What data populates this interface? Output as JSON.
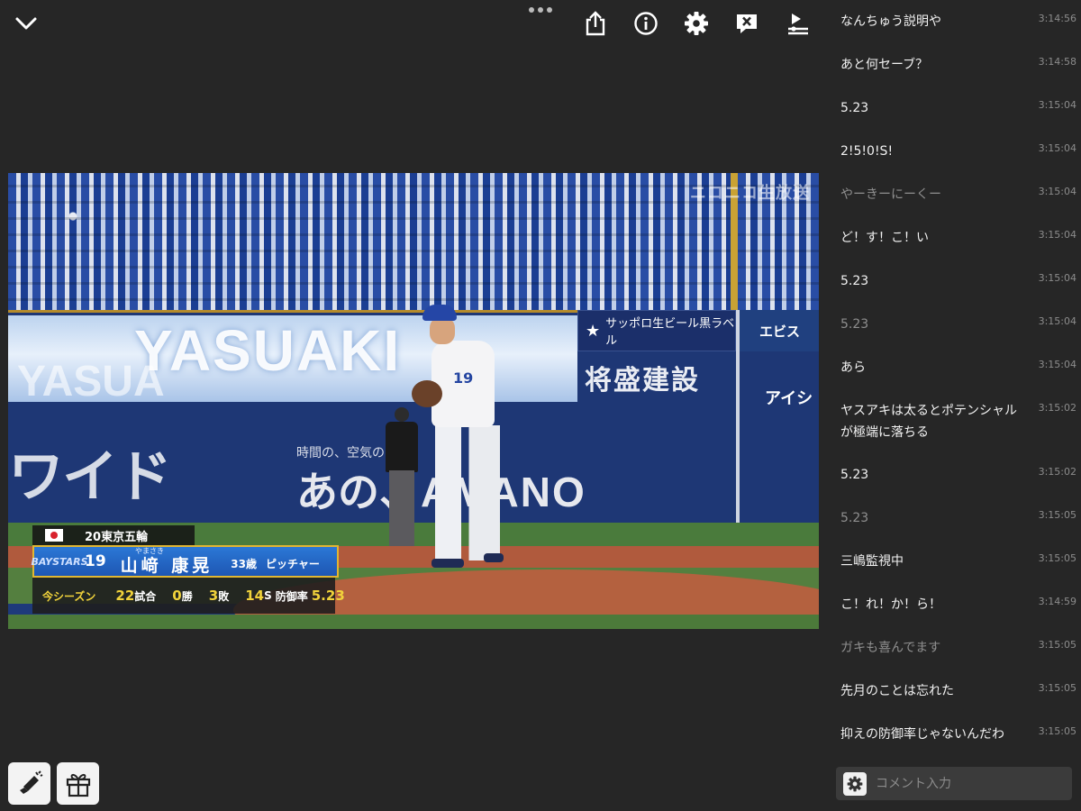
{
  "icons": {
    "collapse": "chevron-down-icon",
    "more": "more-dots-icon",
    "share": "share-icon",
    "info": "info-icon",
    "settings": "gear-icon",
    "hide_comments": "comment-off-icon",
    "playback": "playlist-icon",
    "nicoad": "megaphone-icon",
    "gift": "gift-icon",
    "comment_settings": "gear-icon"
  },
  "video": {
    "broadcast_tag": "ニコニコ生放送",
    "board_text": "YASUAKI",
    "board_text_2": "YASUA",
    "ad_sapporo": "サッポロ生ビール黒ラベル",
    "ad_ebisu": "エビス",
    "ad_shosei": "将盛建設",
    "ad_aisin": "アイシ",
    "ad_wide": "ワイド",
    "ad_sub": "時間の、空気の",
    "ad_mano_prefix": "あの、",
    "ad_mano": "AMANO"
  },
  "player_card": {
    "team_history": "20東京五輪",
    "team_logo": "BAYSTARS",
    "number": "19",
    "name_ruby": "やまさき",
    "name": "山﨑 康晃",
    "age": "33歳",
    "position": "ピッチャー",
    "season_label": "今シーズン",
    "games_value": "22",
    "games_unit": "試合",
    "wins_value": "0",
    "wins_unit": "勝",
    "losses_value": "3",
    "losses_unit": "敗",
    "saves_value": "14",
    "saves_unit": "S",
    "era_label": "防御率",
    "era_value": "5.23"
  },
  "comments": [
    {
      "text": "なんちゅう説明や",
      "time": "3:14:56",
      "dim": false
    },
    {
      "text": "あと何セーブ？",
      "time": "3:14:58",
      "dim": false
    },
    {
      "text": "5.23",
      "time": "3:15:04",
      "dim": false
    },
    {
      "text": "2!5!0!S!",
      "time": "3:15:04",
      "dim": false
    },
    {
      "text": "やーきーにーくー",
      "time": "3:15:04",
      "dim": true
    },
    {
      "text": "ど！す！こ！い",
      "time": "3:15:04",
      "dim": false
    },
    {
      "text": "5.23",
      "time": "3:15:04",
      "dim": false
    },
    {
      "text": "5.23",
      "time": "3:15:04",
      "dim": true
    },
    {
      "text": "あら",
      "time": "3:15:04",
      "dim": false
    },
    {
      "text": "ヤスアキは太るとポテンシャルが極端に落ちる",
      "time": "3:15:02",
      "dim": false
    },
    {
      "text": "5.23",
      "time": "3:15:02",
      "dim": false
    },
    {
      "text": "5.23",
      "time": "3:15:05",
      "dim": true
    },
    {
      "text": "三嶋監視中",
      "time": "3:15:05",
      "dim": false
    },
    {
      "text": "こ！れ！か！ら！",
      "time": "3:14:59",
      "dim": false
    },
    {
      "text": "ガキも喜んでます",
      "time": "3:15:05",
      "dim": true
    },
    {
      "text": "先月のことは忘れた",
      "time": "3:15:05",
      "dim": false
    },
    {
      "text": "抑えの防御率じゃないんだわ",
      "time": "3:15:05",
      "dim": false
    }
  ],
  "comment_input": {
    "placeholder": "コメント入力",
    "value": ""
  }
}
